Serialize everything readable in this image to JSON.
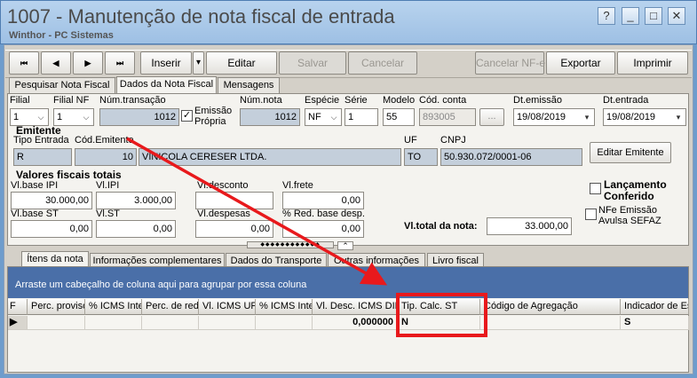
{
  "window": {
    "title": "1007 - Manutenção de nota fiscal de entrada",
    "subtitle": "Winthor - PC Sistemas",
    "controls": [
      "?",
      "_",
      "□",
      "✕"
    ]
  },
  "toolbar": {
    "nav": [
      "⏮",
      "◀",
      "▶",
      "⏭"
    ],
    "inserir": "Inserir",
    "inserir_menu": "▾",
    "editar": "Editar",
    "salvar": "Salvar",
    "cancelar": "Cancelar",
    "cancelar_nfe": "Cancelar NF-e",
    "exportar": "Exportar",
    "imprimir": "Imprimir"
  },
  "top_tabs": [
    "Pesquisar Nota Fiscal",
    "Dados da Nota Fiscal",
    "Mensagens"
  ],
  "header_fields": {
    "filial_label": "Filial",
    "filial_value": "1",
    "filial_nf_label": "Filial NF",
    "filial_nf_value": "1",
    "num_transacao_label": "Núm.transação",
    "num_transacao_value": "1012",
    "emissao_propria_label_1": "Emissão",
    "emissao_propria_label_2": "Própria",
    "emissao_propria_checked": "✓",
    "num_nota_label": "Núm.nota",
    "num_nota_value": "1012",
    "especie_label": "Espécie",
    "especie_value": "NF",
    "serie_label": "Série",
    "serie_value": "1",
    "modelo_label": "Modelo",
    "modelo_value": "55",
    "cod_conta_label": "Cód. conta",
    "cod_conta_value": "893005",
    "cod_conta_btn": "...",
    "dt_emissao_label": "Dt.emissão",
    "dt_emissao_value": "19/08/2019",
    "dt_entrada_label": "Dt.entrada",
    "dt_entrada_value": "19/08/2019"
  },
  "emitente": {
    "section": "Emitente",
    "tipo_entrada_label": "Tipo Entrada",
    "tipo_entrada_value": "R",
    "cod_emitente_label": "Cód.Emitente",
    "cod_emitente_value": "10",
    "nome_value": "VINICOLA CERESER LTDA.",
    "uf_label": "UF",
    "uf_value": "TO",
    "cnpj_label": "CNPJ",
    "cnpj_value": "50.930.072/0001-06",
    "editar_button": "Editar Emitente"
  },
  "valores": {
    "section": "Valores fiscais totais",
    "vl_base_ipi_label": "Vl.base IPI",
    "vl_base_ipi_value": "30.000,00",
    "vl_ipi_label": "Vl.IPI",
    "vl_ipi_value": "3.000,00",
    "vl_desconto_label": "Vl.desconto",
    "vl_desconto_value": "",
    "vl_frete_label": "Vl.frete",
    "vl_frete_value": "0,00",
    "vl_base_st_label": "Vl.base ST",
    "vl_base_st_value": "0,00",
    "vl_st_label": "Vl.ST",
    "vl_st_value": "0,00",
    "vl_despesas_label": "Vl.despesas",
    "vl_despesas_value": "0,00",
    "red_base_label": "% Red. base desp.",
    "red_base_value": "0,00",
    "vl_total_label": "Vl.total da nota:",
    "vl_total_value": "33.000,00",
    "lancamento_label_1": "Lançamento",
    "lancamento_label_2": "Conferido",
    "nfe_label_1": "NFe Emissão",
    "nfe_label_2": "Avulsa SEFAZ"
  },
  "bottom_tabs": [
    "Ítens da nota",
    "Informações complementares",
    "Dados do Transporte",
    "Outras informações",
    "Livro fiscal"
  ],
  "grid": {
    "group_hint": "Arraste um cabeçalho de coluna aqui para agrupar por essa coluna",
    "headers": [
      "F",
      "Perc. proviso",
      "% ICMS Inte",
      "Perc. de red",
      "Vl. ICMS UF",
      "% ICMS Inte",
      "Vl. Desc. ICMS DIF",
      "Tip. Calc. ST",
      "Código de Agregação",
      "Indicador de Es"
    ],
    "row": [
      "",
      "",
      "",
      "",
      "",
      "",
      "0,000000",
      "N",
      "",
      "S"
    ]
  },
  "colors": {
    "highlight_box": "#e8191c",
    "arrow": "#e8191c",
    "group_bar": "#4a6fa8"
  }
}
